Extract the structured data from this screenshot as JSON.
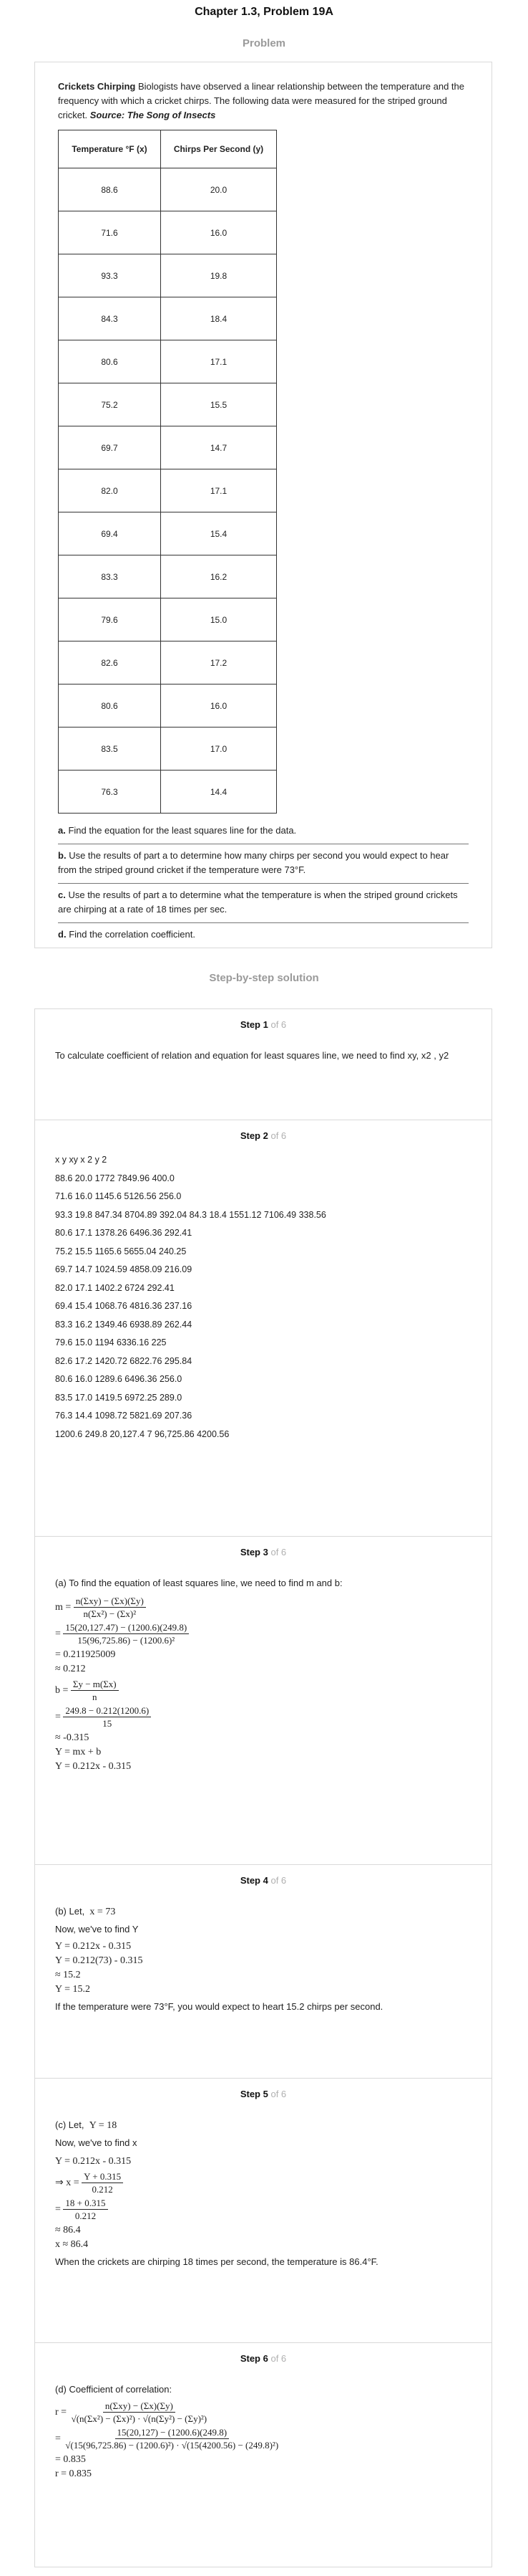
{
  "title": "Chapter 1.3, Problem 19A",
  "problem_heading": "Problem",
  "problem": {
    "lead": "Crickets Chirping",
    "text": "Biologists have observed a linear relationship between the temperature and the frequency with which a cricket chirps. The following data were measured for the striped ground cricket.",
    "source": "Source: The Song of Insects",
    "table": {
      "headers": [
        "Temperature °F (x)",
        "Chirps Per Second (y)"
      ],
      "rows": [
        [
          "88.6",
          "20.0"
        ],
        [
          "71.6",
          "16.0"
        ],
        [
          "93.3",
          "19.8"
        ],
        [
          "84.3",
          "18.4"
        ],
        [
          "80.6",
          "17.1"
        ],
        [
          "75.2",
          "15.5"
        ],
        [
          "69.7",
          "14.7"
        ],
        [
          "82.0",
          "17.1"
        ],
        [
          "69.4",
          "15.4"
        ],
        [
          "83.3",
          "16.2"
        ],
        [
          "79.6",
          "15.0"
        ],
        [
          "82.6",
          "17.2"
        ],
        [
          "80.6",
          "16.0"
        ],
        [
          "83.5",
          "17.0"
        ],
        [
          "76.3",
          "14.4"
        ]
      ]
    },
    "questions": [
      {
        "label": "a.",
        "text": "Find the equation for the least squares line for the data."
      },
      {
        "label": "b.",
        "text": "Use the results of part a to determine how many chirps per second you would expect to hear from the striped ground cricket if the temperature were 73°F."
      },
      {
        "label": "c.",
        "text": "Use the results of part a to determine what the temperature is when the striped ground crickets are chirping at a rate of 18 times per sec."
      },
      {
        "label": "d.",
        "text": "Find the correlation coefficient."
      }
    ]
  },
  "solution_heading": "Step-by-step solution",
  "steps": [
    {
      "label": "Step 1",
      "of": "of 6",
      "text": "To calculate coefficient of relation and equation for least squares line, we need to find xy, x2 , y2"
    },
    {
      "label": "Step 2",
      "of": "of 6",
      "lines": [
        "x y xy x 2 y 2",
        "88.6 20.0 1772 7849.96 400.0",
        "71.6 16.0 1145.6 5126.56 256.0",
        "93.3 19.8 847.34 8704.89 392.04 84.3 18.4 1551.12 7106.49 338.56",
        "80.6 17.1 1378.26 6496.36 292.41",
        "75.2 15.5 1165.6 5655.04 240.25",
        "69.7 14.7 1024.59 4858.09 216.09",
        "82.0 17.1 1402.2 6724 292.41",
        "69.4 15.4 1068.76 4816.36 237.16",
        "83.3 16.2 1349.46 6938.89 262.44",
        "79.6 15.0 1194 6336.16 225",
        "82.6 17.2 1420.72 6822.76 295.84",
        "80.6 16.0 1289.6 6496.36 256.0",
        "83.5 17.0 1419.5 6972.25 289.0",
        "76.3 14.4 1098.72 5821.69 207.36",
        "1200.6 249.8 20,127.4 7 96,725.86 4200.56"
      ]
    },
    {
      "label": "Step 3",
      "of": "of 6",
      "intro": "(a) To find the equation of least squares line, we need to find m and b:",
      "m_num": "n(Σxy) − (Σx)(Σy)",
      "m_den": "n(Σx²) − (Σx)²",
      "m_sub_num": "15(20,127.47) − (1200.6)(249.8)",
      "m_sub_den": "15(96,725.86) − (1200.6)²",
      "m_val1": "= 0.211925009",
      "m_val2": "≈ 0.212",
      "b_num": "Σy − m(Σx)",
      "b_den": "n",
      "b_sub_num": "249.8 − 0.212(1200.6)",
      "b_sub_den": "15",
      "b_val": "≈ -0.315",
      "eq1": "Y = mx + b",
      "eq2": "Y = 0.212x - 0.315"
    },
    {
      "label": "Step 4",
      "of": "of 6",
      "intro": "(b) Let,",
      "let": "x = 73",
      "find": "Now, we've to find Y",
      "lines": [
        "Y = 0.212x - 0.315",
        "Y = 0.212(73) - 0.315",
        "≈ 15.2",
        "Y = 15.2"
      ],
      "conclusion": "If the temperature were 73°F, you would expect to heart 15.2 chirps per second."
    },
    {
      "label": "Step 5",
      "of": "of 6",
      "intro": "(c) Let,",
      "let": "Y = 18",
      "find": "Now, we've to find x",
      "line1": "Y = 0.212x - 0.315",
      "frac1_num": "Y + 0.315",
      "frac1_den": "0.212",
      "frac2_num": "18 + 0.315",
      "frac2_den": "0.212",
      "line2": "≈ 86.4",
      "line3": "x ≈ 86.4",
      "conclusion": "When the crickets are chirping 18 times per second, the temperature is 86.4°F."
    },
    {
      "label": "Step 6",
      "of": "of 6",
      "intro": "(d) Coefficient of correlation:",
      "r_num": "n(Σxy) − (Σx)(Σy)",
      "r_den": "√(n(Σx²) − (Σx)²) · √(n(Σy²) − (Σy)²)",
      "r_sub_num": "15(20,127) − (1200.6)(249.8)",
      "r_sub_den": "√(15(96,725.86) − (1200.6)²) · √(15(4200.56) − (249.8)²)",
      "r_val1": "= 0.835",
      "r_val2": "r = 0.835"
    }
  ]
}
